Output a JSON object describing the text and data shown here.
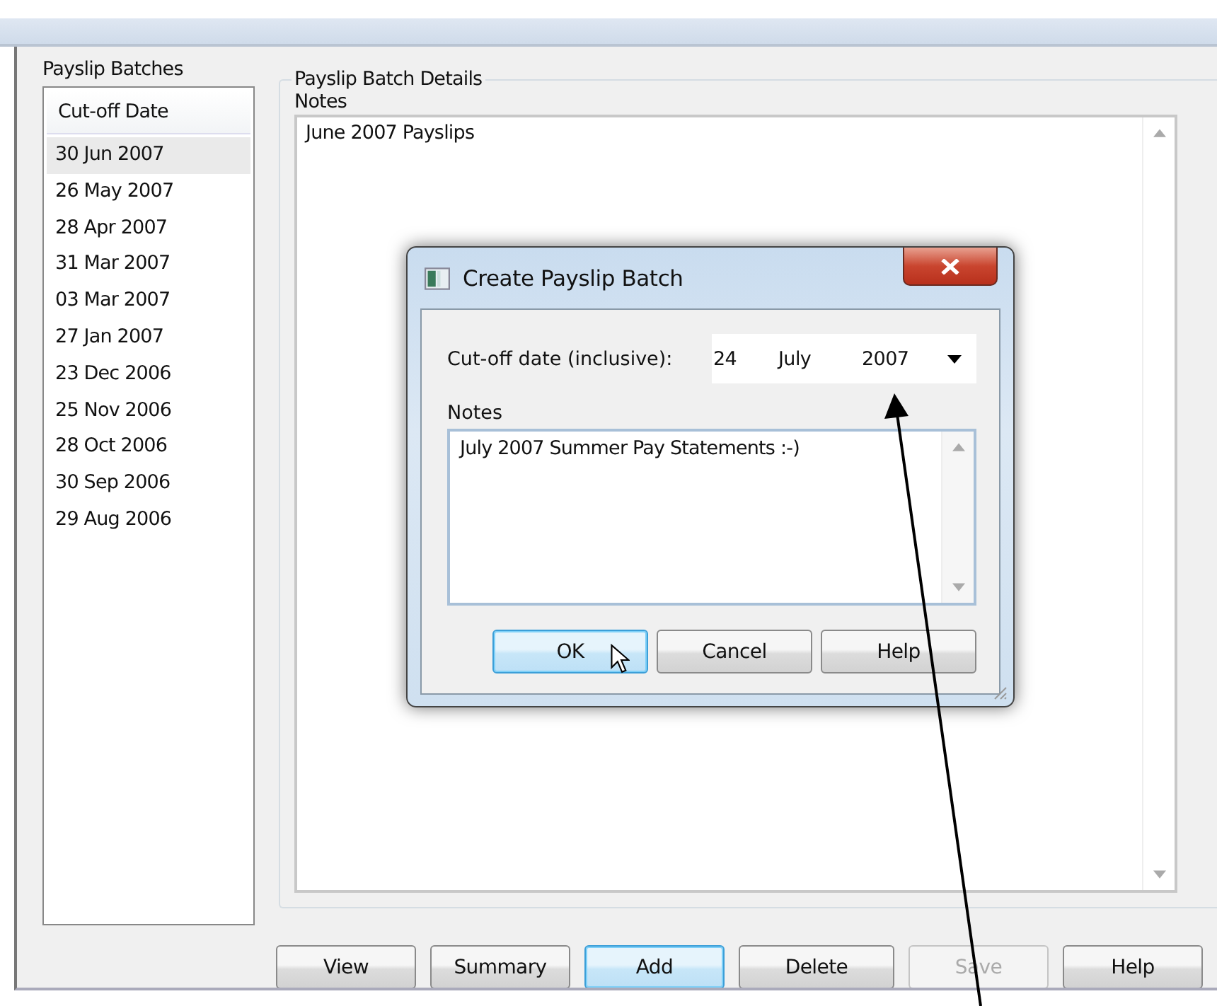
{
  "batches": {
    "label": "Payslip Batches",
    "column": "Cut-off Date",
    "rows": [
      {
        "date": "30 Jun 2007",
        "selected": true
      },
      {
        "date": "26 May 2007",
        "selected": false
      },
      {
        "date": "28 Apr 2007",
        "selected": false
      },
      {
        "date": "31 Mar 2007",
        "selected": false
      },
      {
        "date": "03 Mar 2007",
        "selected": false
      },
      {
        "date": "27 Jan 2007",
        "selected": false
      },
      {
        "date": "23 Dec 2006",
        "selected": false
      },
      {
        "date": "25 Nov 2006",
        "selected": false
      },
      {
        "date": "28 Oct 2006",
        "selected": false
      },
      {
        "date": "30 Sep 2006",
        "selected": false
      },
      {
        "date": "29 Aug 2006",
        "selected": false
      }
    ]
  },
  "details": {
    "label": "Payslip Batch Details",
    "notes_label": "Notes",
    "notes": "June 2007 Payslips"
  },
  "buttons": [
    {
      "label": "View",
      "disabled": false,
      "focused": false
    },
    {
      "label": "Summary",
      "disabled": false,
      "focused": false
    },
    {
      "label": "Add",
      "disabled": false,
      "focused": true
    },
    {
      "label": "Delete",
      "disabled": false,
      "focused": false
    },
    {
      "label": "Save",
      "disabled": true,
      "focused": false
    },
    {
      "label": "Help",
      "disabled": false,
      "focused": false
    }
  ],
  "dialog": {
    "title": "Create Payslip Batch",
    "date_label": "Cut-off date (inclusive):",
    "day": "24",
    "month": "July",
    "year": "2007",
    "notes_label": "Notes",
    "notes": "July 2007 Summer Pay Statements  :-)",
    "buttons": [
      {
        "label": "OK",
        "focused": true
      },
      {
        "label": "Cancel",
        "focused": false
      },
      {
        "label": "Help",
        "focused": false
      }
    ]
  }
}
